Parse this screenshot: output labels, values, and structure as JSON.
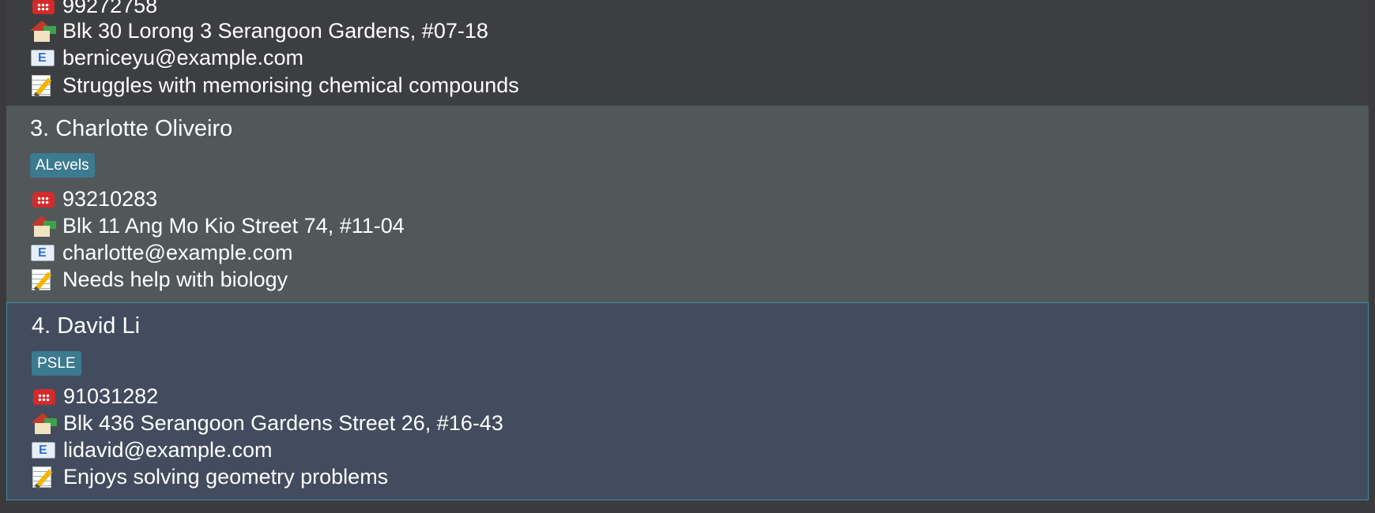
{
  "persons": [
    {
      "index_label": "",
      "tag": "",
      "phone": "99272758",
      "address": "Blk 30 Lorong 3 Serangoon Gardens, #07-18",
      "email": "berniceyu@example.com",
      "note": "Struggles with memorising chemical compounds"
    },
    {
      "index_label": "3. Charlotte Oliveiro",
      "tag": "ALevels",
      "phone": "93210283",
      "address": "Blk 11 Ang Mo Kio Street 74, #11-04",
      "email": "charlotte@example.com",
      "note": "Needs help with biology"
    },
    {
      "index_label": "4. David Li",
      "tag": "PSLE",
      "phone": "91031282",
      "address": "Blk 436 Serangoon Gardens Street 26, #16-43",
      "email": "lidavid@example.com",
      "note": "Enjoys solving geometry problems"
    }
  ],
  "icons": {
    "phone": "phone-icon",
    "address": "house-icon",
    "email": "email-icon",
    "note": "memo-icon"
  },
  "colors": {
    "tag_background": "#3b7a8f",
    "selected_border": "#3d8fa6",
    "selected_background": "#424c5e",
    "card_alt_background": "#525759",
    "card_background": "#3d3e41"
  }
}
